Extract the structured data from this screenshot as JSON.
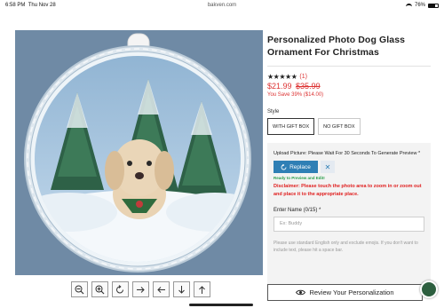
{
  "status_bar": {
    "time": "6:58 PM",
    "date": "Thu Nov 28",
    "url": "bakven.com",
    "battery": "76%"
  },
  "product": {
    "title": "Personalized Photo Dog Glass Ornament For Christmas",
    "rating_stars": "★★★★★",
    "rating_value": 5,
    "review_count": "(1)",
    "price_now": "$21.99",
    "price_was": "$35.99",
    "save_text": "You Save 39% ($14.00)"
  },
  "style": {
    "label": "Style",
    "options": [
      "WITH GIFT BOX",
      "NO GIFT BOX"
    ],
    "selected": "WITH GIFT BOX"
  },
  "customize": {
    "upload_label": "Upload Picture: Please Wait For 30 Seconds To Generate Preview *",
    "replace_label": "Replace",
    "remove_label": "✕",
    "ready_text": "Ready to Preview and Edit!",
    "disclaimer": "Disclaimer: Please touch the photo area to zoom in or zoom out and place it to the appropriate place.",
    "engraving_label": "Enter Name (0/15) *",
    "engraving_placeholder": "Ex: Buddy",
    "engraving_value": "",
    "note": "Please use standard English only and exclude emojis. If you don't want to include text, please hit a space bar."
  },
  "image_tools": [
    "zoom-out-icon",
    "zoom-in-icon",
    "rotate-icon",
    "move-right-icon",
    "move-left-icon",
    "move-down-icon",
    "move-up-icon"
  ],
  "review_button": "Review Your Personalization",
  "colors": {
    "accent_red": "#dd3333",
    "replace_blue": "#2f7fb5",
    "ready_green": "#2a9d4a",
    "photo_bg": "#6f8aa5"
  }
}
